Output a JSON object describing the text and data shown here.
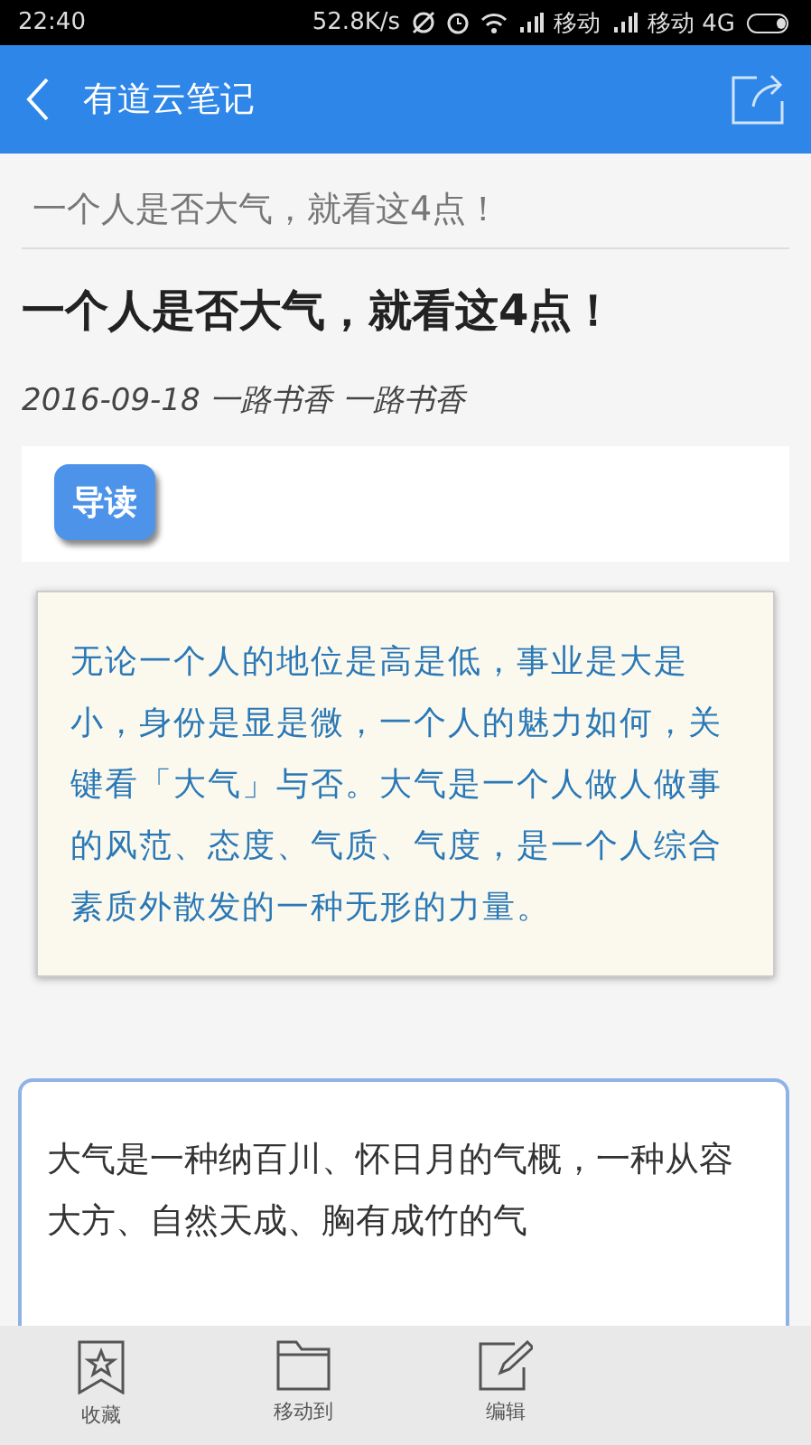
{
  "status_bar": {
    "time": "22:40",
    "speed": "52.8K/s",
    "carrier_1": "移动",
    "carrier_2": "移动 4G"
  },
  "app_bar": {
    "title": "有道云笔记"
  },
  "note": {
    "heading": "一个人是否大气，就看这4点！",
    "title": "一个人是否大气，就看这4点！",
    "meta": "2016-09-18 一路书香 一路书香",
    "guide_label": "导读",
    "summary": "无论一个人的地位是高是低，事业是大是小，身份是显是微，一个人的魅力如何，关键看「大气」与否。大气是一个人做人做事的风范、态度、气质、气度，是一个人综合素质外散发的一种无形的力量。",
    "paragraph": "大气是一种纳百川、怀日月的气概，一种从容大方、自然天成、胸有成竹的气"
  },
  "toolbar": [
    {
      "kind": "favorite",
      "label": "收藏"
    },
    {
      "kind": "move",
      "label": "移动到"
    },
    {
      "kind": "edit",
      "label": "编辑"
    }
  ]
}
